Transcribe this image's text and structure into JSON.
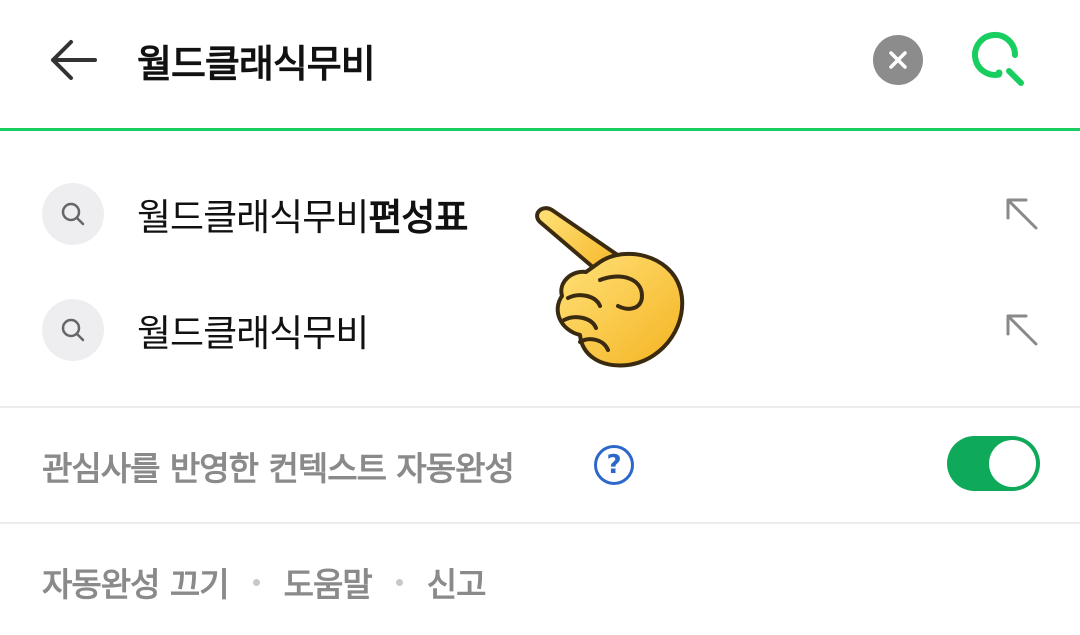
{
  "header": {
    "query": "월드클래식무비",
    "back_icon": "back-arrow-icon",
    "clear_icon": "clear-icon",
    "search_icon": "search-icon"
  },
  "suggestions": [
    {
      "prefix": "월드클래식무비",
      "highlight": "편성표",
      "icon": "search-icon",
      "action_icon": "fill-query-arrow-icon"
    },
    {
      "prefix": "월드클래식무비",
      "highlight": "",
      "icon": "search-icon",
      "action_icon": "fill-query-arrow-icon"
    }
  ],
  "context_autocomplete": {
    "label": "관심사를 반영한 컨텍스트 자동완성",
    "help_glyph": "?",
    "enabled": true
  },
  "footer": {
    "links": [
      "자동완성 끄기",
      "도움말",
      "신고"
    ]
  },
  "colors": {
    "accent_green": "#19ce60",
    "toggle_green": "#0fa95a",
    "help_blue": "#2d67c9",
    "muted_text": "#8a8a8a"
  },
  "overlay": {
    "emoji": "pointing-hand"
  }
}
